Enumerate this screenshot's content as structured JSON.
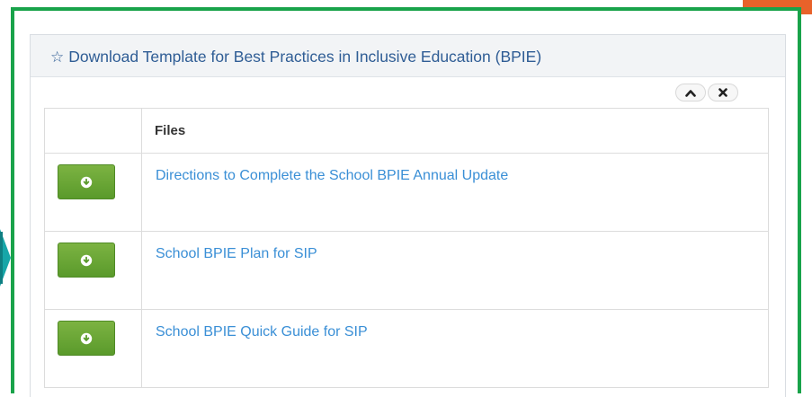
{
  "widget": {
    "star_glyph": "☆",
    "title": "Download Template for Best Practices in Inclusive Education (BPIE)",
    "collapse_icon": "chevron-up-icon",
    "close_icon": "close-icon"
  },
  "table": {
    "columns": [
      "",
      "Files"
    ],
    "rows": [
      {
        "file": "Directions to Complete the School BPIE Annual Update",
        "action_icon": "download-icon"
      },
      {
        "file": "School BPIE Plan for SIP",
        "action_icon": "download-icon"
      },
      {
        "file": "School BPIE Quick Guide for SIP",
        "action_icon": "download-icon"
      }
    ]
  },
  "colors": {
    "highlight_border": "#19a34a",
    "title_text": "#2f5d95",
    "link": "#3a8fd6",
    "button_green": "#6aa535"
  }
}
